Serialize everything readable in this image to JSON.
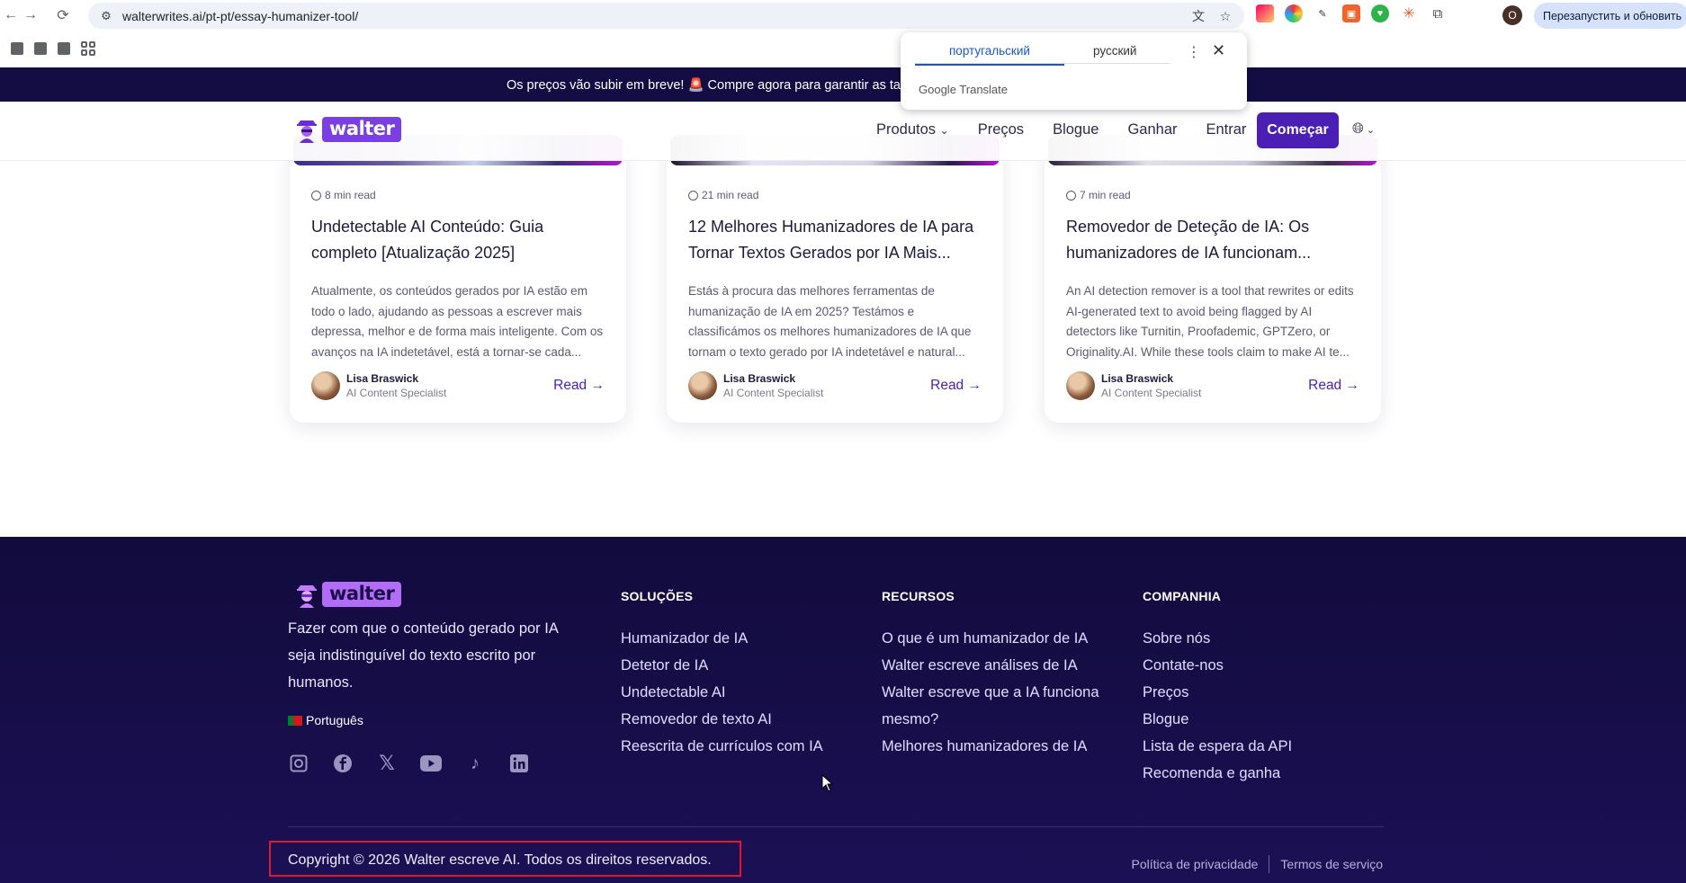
{
  "browser": {
    "url": "walterwrites.ai/pt-pt/essay-humanizer-tool/",
    "relaunch_label": "Перезапустить и обновить",
    "profile_initial": "O",
    "translate_popup": {
      "source_lang": "португальский",
      "target_lang": "русский",
      "brand": "Google Translate"
    }
  },
  "announcement": {
    "text": "Os preços vão subir em breve! 🚨 Compre agora para garantir as taxas"
  },
  "header": {
    "logo_text": "walter",
    "nav": [
      "Produtos",
      "Preços",
      "Blogue",
      "Ganhar",
      "Entrar"
    ],
    "cta_label": "Começar"
  },
  "cards": [
    {
      "read_time": "8 min read",
      "title": "Undetectable AI Conteúdo: Guia completo [Atualização 2025]",
      "excerpt": "Atualmente, os conteúdos gerados por IA estão em todo o lado, ajudando as pessoas a escrever mais depressa, melhor e de forma mais inteligente. Com os avanços na IA indetetável, está a tornar-se cada...",
      "author_name": "Lisa Braswick",
      "author_role": "AI Content Specialist",
      "read_label": "Read"
    },
    {
      "read_time": "21 min read",
      "title": "12 Melhores Humanizadores de IA para Tornar Textos Gerados por IA Mais...",
      "excerpt": "Estás à procura das melhores ferramentas de humanização de IA em 2025? Testámos e classificámos os melhores humanizadores de IA que tornam o texto gerado por IA indetetável e natural...",
      "author_name": "Lisa Braswick",
      "author_role": "AI Content Specialist",
      "read_label": "Read"
    },
    {
      "read_time": "7 min read",
      "title": "Removedor de Deteção de IA: Os humanizadores de IA funcionam...",
      "excerpt": "An AI detection remover is a tool that rewrites or edits AI-generated text to avoid being flagged by AI detectors like Turnitin, Proofademic, GPTZero, or Originality.AI. While these tools claim to make AI te...",
      "author_name": "Lisa Braswick",
      "author_role": "AI Content Specialist",
      "read_label": "Read"
    }
  ],
  "footer": {
    "logo_text": "walter",
    "tagline": "Fazer com que o conteúdo gerado por IA seja indistinguível do texto escrito por humanos.",
    "language": "Português",
    "columns": [
      {
        "title": "SOLUÇÕES",
        "links": [
          "Humanizador de IA",
          "Detetor de IA",
          "Undetectable AI",
          "Removedor de texto AI",
          "Reescrita de currículos com IA"
        ]
      },
      {
        "title": "RECURSOS",
        "links": [
          "O que é um humanizador de IA",
          "Walter escreve análises de IA",
          "Walter escreve que a IA funciona",
          "mesmo?",
          "Melhores humanizadores de IA"
        ]
      },
      {
        "title": "COMPANHIA",
        "links": [
          "Sobre nós",
          "Contate-nos",
          "Preços",
          "Blogue",
          "Lista de espera da API",
          "Recomenda e ganha"
        ]
      }
    ],
    "copyright": "Copyright © 2026 Walter escreve AI. Todos os direitos reservados.",
    "privacy": "Política de privacidade",
    "terms": "Termos de serviço"
  },
  "colors": {
    "brand_purple": "#4b1fb3",
    "footer_bg": "#120b3d",
    "highlight_red": "#e3162b"
  }
}
